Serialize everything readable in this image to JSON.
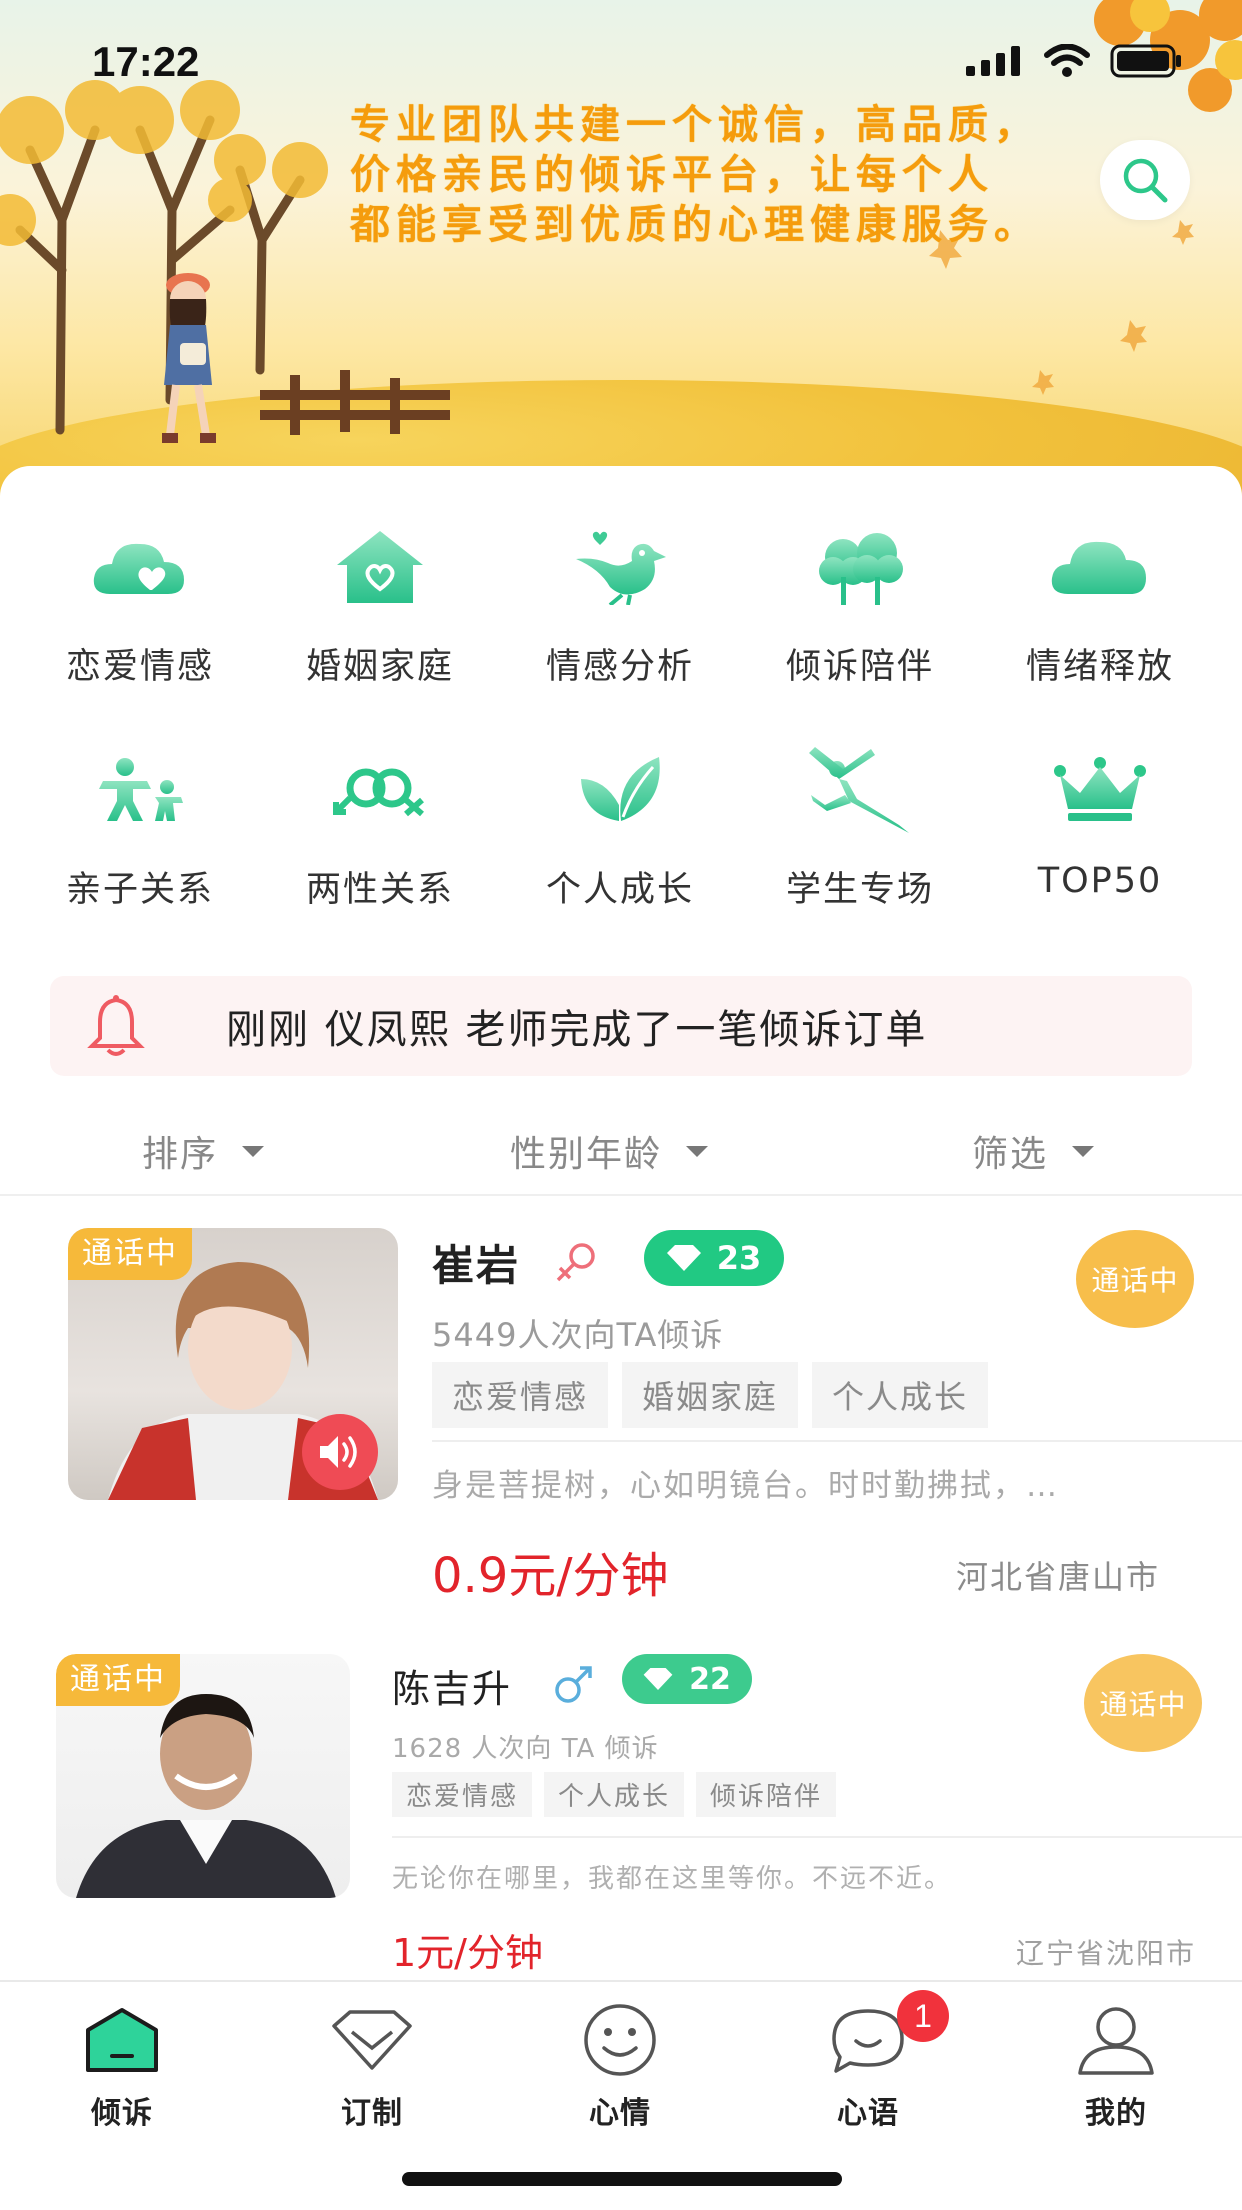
{
  "status_bar": {
    "time": "17:22"
  },
  "banner": {
    "slogan_lines": [
      "专业团队共建一个诚信，高品质，",
      "价格亲民的倾诉平台，让每个人",
      "都能享受到优质的心理健康服务。"
    ],
    "search_icon": "search-icon"
  },
  "categories": [
    {
      "label": "恋爱情感",
      "icon": "hearts-cloud-icon"
    },
    {
      "label": "婚姻家庭",
      "icon": "house-heart-icon"
    },
    {
      "label": "情感分析",
      "icon": "bird-icon"
    },
    {
      "label": "倾诉陪伴",
      "icon": "trees-icon"
    },
    {
      "label": "情绪释放",
      "icon": "cloud-icon"
    },
    {
      "label": "亲子关系",
      "icon": "parent-child-icon"
    },
    {
      "label": "两性关系",
      "icon": "gender-rings-icon"
    },
    {
      "label": "个人成长",
      "icon": "leaf-icon"
    },
    {
      "label": "学生专场",
      "icon": "dancer-icon"
    },
    {
      "label": "TOP50",
      "icon": "crown-icon"
    }
  ],
  "notice": {
    "text": "刚刚 仪凤熙 老师完成了一笔倾诉订单",
    "icon": "bell-icon"
  },
  "filters": [
    {
      "label": "排序"
    },
    {
      "label": "性别年龄"
    },
    {
      "label": "筛选"
    }
  ],
  "listeners": [
    {
      "status_tag": "通话中",
      "name": "崔岩",
      "gender_icon": "female-icon",
      "level": "23",
      "calls": "5449人次向TA倾诉",
      "tags": [
        "恋爱情感",
        "婚姻家庭",
        "个人成长"
      ],
      "quote": "身是菩提树，心如明镜台。时时勤拂拭，…",
      "price": "0.9元/分钟",
      "city": "河北省唐山市",
      "call_button": "通话中"
    },
    {
      "status_tag": "通话中",
      "name": "陈吉升",
      "gender_icon": "male-icon",
      "level": "22",
      "calls": "1628 人次向 TA 倾诉",
      "tags": [
        "恋爱情感",
        "个人成长",
        "倾诉陪伴"
      ],
      "quote": "无论你在哪里，我都在这里等你。不远不近。",
      "price": "1元/分钟",
      "city": "辽宁省沈阳市",
      "call_button": "通话中"
    }
  ],
  "tabbar": [
    {
      "label": "倾诉",
      "icon": "home-icon",
      "active": true
    },
    {
      "label": "订制",
      "icon": "diamond-icon"
    },
    {
      "label": "心情",
      "icon": "smile-icon"
    },
    {
      "label": "心语",
      "icon": "chat-icon",
      "badge": "1"
    },
    {
      "label": "我的",
      "icon": "profile-icon"
    }
  ],
  "colors": {
    "accent_green": "#21c983",
    "slogan_orange": "#f59c0d",
    "live_orange": "#f7be4b",
    "price_red": "#e2242b",
    "badge_red": "#f1323c"
  }
}
